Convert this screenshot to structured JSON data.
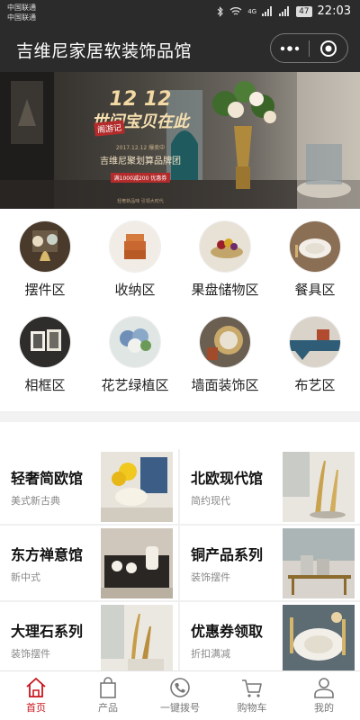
{
  "status_bar": {
    "carrier_1": "中国联通",
    "carrier_2": "中国联通",
    "network": "4G",
    "battery": "47",
    "time": "22:03"
  },
  "nav": {
    "title": "吉维尼家居软装饰品馆",
    "more_icon": "more-dots-icon",
    "close_icon": "target-circle-icon"
  },
  "banner": {
    "headline": "12 12",
    "slogan": "世间宝贝在此",
    "brand_tag": "阁游记",
    "date_line": "2017.12.12 爆卖中",
    "group": "吉维尼聚划算品牌团",
    "promo": "满1000减200 优惠券",
    "footer": "轻奢新品味 引领大时代"
  },
  "categories": [
    {
      "label": "摆件区",
      "icon": "ornament-photo"
    },
    {
      "label": "收纳区",
      "icon": "storage-box-photo"
    },
    {
      "label": "果盘储物区",
      "icon": "fruit-plate-photo"
    },
    {
      "label": "餐具区",
      "icon": "tableware-photo"
    },
    {
      "label": "相框区",
      "icon": "photo-frame-photo"
    },
    {
      "label": "花艺绿植区",
      "icon": "flower-photo"
    },
    {
      "label": "墙面装饰区",
      "icon": "wall-decor-photo"
    },
    {
      "label": "布艺区",
      "icon": "fabric-photo"
    }
  ],
  "features": [
    {
      "title": "轻奢简欧馆",
      "subtitle": "美式新古典"
    },
    {
      "title": "北欧现代馆",
      "subtitle": "简约现代"
    },
    {
      "title": "东方禅意馆",
      "subtitle": "新中式"
    },
    {
      "title": "铜产品系列",
      "subtitle": "装饰摆件"
    },
    {
      "title": "大理石系列",
      "subtitle": "装饰摆件"
    },
    {
      "title": "优惠券领取",
      "subtitle": "折扣满减"
    }
  ],
  "tabbar": [
    {
      "label": "首页",
      "icon": "home-icon",
      "active": true
    },
    {
      "label": "产品",
      "icon": "bag-icon",
      "active": false
    },
    {
      "label": "一键拨号",
      "icon": "phone-icon",
      "active": false
    },
    {
      "label": "购物车",
      "icon": "cart-icon",
      "active": false
    },
    {
      "label": "我的",
      "icon": "user-icon",
      "active": false
    }
  ],
  "colors": {
    "header_bg": "#2b2b2b",
    "accent": "#c8161d",
    "page_bg": "#ffffff"
  }
}
